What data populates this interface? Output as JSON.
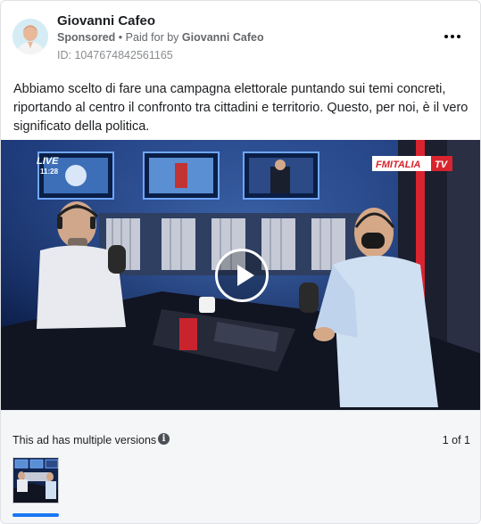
{
  "ad": {
    "advertiser_name": "Giovanni Cafeo",
    "sponsored_label": "Sponsored",
    "separator": "•",
    "paid_for_prefix": "Paid for by",
    "paid_for_by": "Giovanni Cafeo",
    "id_text": "ID: 1047674842561165",
    "body_text": "Abbiamo scelto di fare una campagna elettorale puntando sui temi concreti, riportando al centro il confronto tra cittadini e territorio. Questo, per noi, è il vero significato della politica."
  },
  "video": {
    "live_label": "LIVE",
    "clock": "11:28",
    "channel_logo": "FMITALIA",
    "channel_logo_suffix": "TV",
    "play_icon": "play-icon"
  },
  "versions": {
    "label": "This ad has multiple versions",
    "info_icon": "info-icon",
    "pager": "1 of 1",
    "selected_color": "#1877f2"
  },
  "icons": {
    "more": "more-horizontal-icon",
    "avatar": "avatar"
  }
}
